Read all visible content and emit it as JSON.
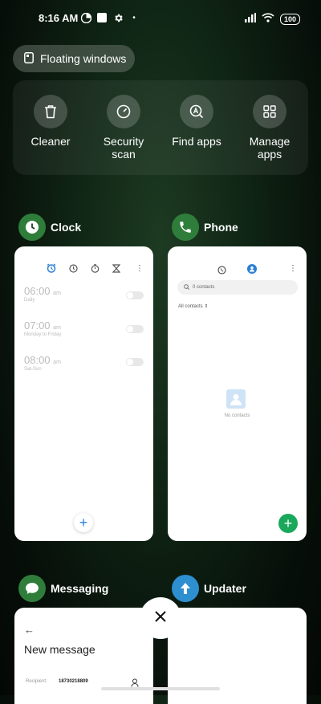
{
  "status": {
    "time": "8:16 AM",
    "battery": "100",
    "dot": "•"
  },
  "chip": {
    "label": "Floating windows"
  },
  "quick_actions": [
    {
      "label": "Cleaner",
      "icon": "trash-icon"
    },
    {
      "label": "Security scan",
      "icon": "speed-gauge-icon"
    },
    {
      "label": "Find apps",
      "icon": "search-a-icon"
    },
    {
      "label": "Manage apps",
      "icon": "grid-icon"
    }
  ],
  "apps": {
    "clock": {
      "name": "Clock",
      "alarms": [
        {
          "time": "06:00",
          "ampm": "am",
          "sub": "Daily"
        },
        {
          "time": "07:00",
          "ampm": "am",
          "sub": "Monday to Friday"
        },
        {
          "time": "08:00",
          "ampm": "am",
          "sub": "Sat-Sun"
        }
      ],
      "fab": "+"
    },
    "phone": {
      "name": "Phone",
      "search_placeholder": "0 contacts",
      "filter": "All contacts",
      "empty": "No contacts",
      "fab": "+"
    },
    "messaging": {
      "name": "Messaging",
      "title": "New message",
      "recipient_label": "Recipient:",
      "recipient_value": "18730218809"
    },
    "updater": {
      "name": "Updater"
    }
  },
  "colors": {
    "clock_icon": "#2f7d3a",
    "phone_icon": "#2f7d3a",
    "messaging_icon": "#2f7d3a",
    "updater_icon": "#2d8fd0",
    "phone_fab": "#1aa85a",
    "clock_fab": "#2b7fd6"
  }
}
